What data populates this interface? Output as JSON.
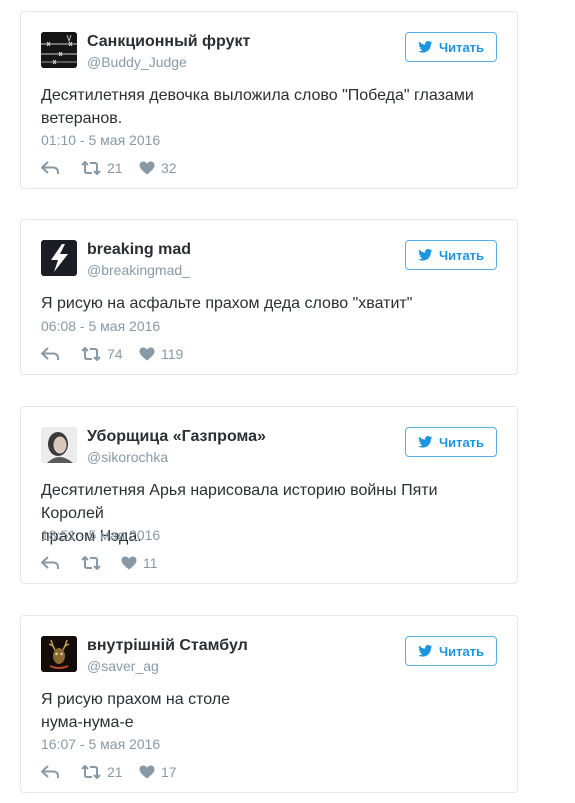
{
  "colors": {
    "accent": "#1b95e0",
    "border": "#e1e8ed",
    "muted": "#8899a6",
    "text": "#292f33"
  },
  "icons": {
    "reply": "reply-icon",
    "retweet": "retweet-icon",
    "like": "heart-icon",
    "follow": "twitter-bird-icon"
  },
  "tweets": [
    {
      "name": "Санкционный фрукт",
      "handle": "@Buddy_Judge",
      "follow_label": "Читать",
      "text_lines": [
        "Десятилетняя девочка выложила слово \"Победа\" глазами",
        "ветеранов."
      ],
      "time": "01:10 - 5 мая 2016",
      "retweets": "21",
      "likes": "32"
    },
    {
      "name": "breaking mad",
      "handle": "@breakingmad_",
      "follow_label": "Читать",
      "text_lines": [
        "Я рисую на асфальте прахом деда слово \"хватит\""
      ],
      "time": "06:08 - 5 мая 2016",
      "retweets": "74",
      "likes": "119"
    },
    {
      "name": "Уборщица «Газпрома»",
      "handle": "@sikorochka",
      "follow_label": "Читать",
      "text_lines": [
        "Десятилетняя Арья нарисовала историю войны Пяти Королей",
        "прахом Нэда."
      ],
      "time": "18:51 - 5 мая 2016",
      "retweets": "",
      "likes": "11"
    },
    {
      "name": "внутрішній Стамбул",
      "handle": "@saver_ag",
      "follow_label": "Читать",
      "text_lines": [
        "Я рисую прахом на столе",
        "нума-нума-е"
      ],
      "time": "16:07 - 5 мая 2016",
      "retweets": "21",
      "likes": "17"
    }
  ]
}
